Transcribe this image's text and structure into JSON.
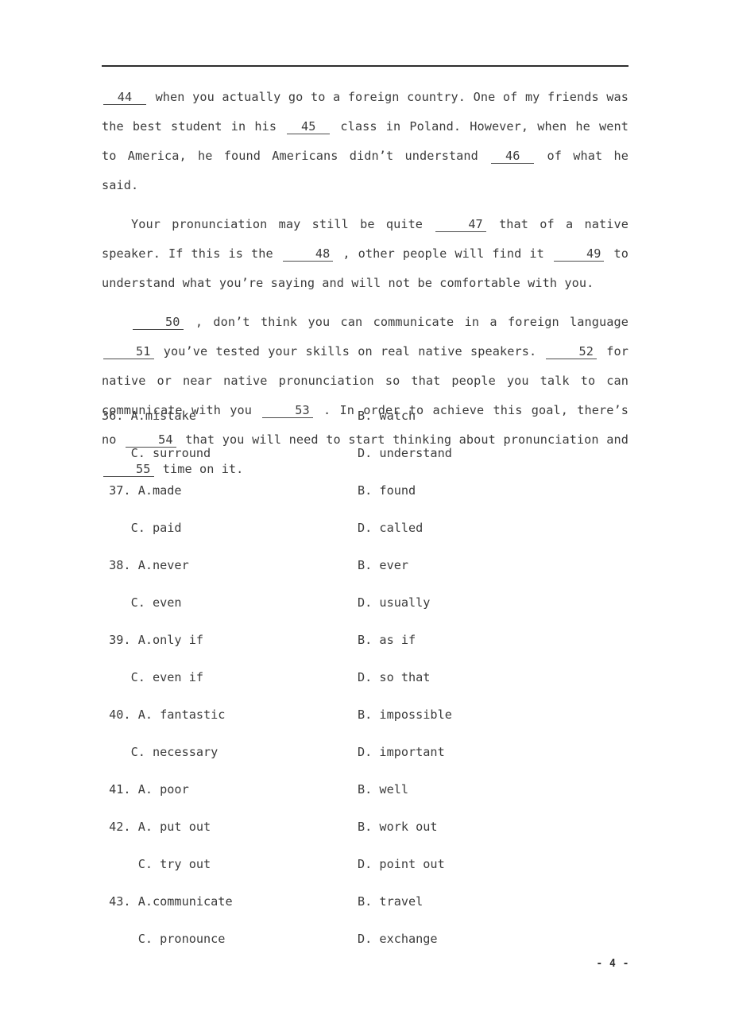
{
  "document": {
    "page_number_label": "- 4 -",
    "rule": true
  },
  "passage": {
    "paragraphs": [
      {
        "id": "p1",
        "indent": false,
        "segments": [
          {
            "type": "blank",
            "text": "44"
          },
          {
            "type": "text",
            "text": "  when you actually go to a foreign country. One of my friends was the best student in his "
          },
          {
            "type": "blank",
            "text": "45"
          },
          {
            "type": "text",
            "text": "  class in Poland. However, when he went to America, he found Americans didn’t understand "
          },
          {
            "type": "blank",
            "text": "46"
          },
          {
            "type": "text",
            "text": "  of what he said."
          }
        ]
      },
      {
        "id": "p2",
        "indent": true,
        "segments": [
          {
            "type": "text",
            "text": "Your pronunciation may still be quite "
          },
          {
            "type": "blank",
            "text": "47"
          },
          {
            "type": "text",
            "text": "  that of a native speaker. If this is the "
          },
          {
            "type": "blank",
            "text": "48"
          },
          {
            "type": "text",
            "text": " , other people will find it "
          },
          {
            "type": "blank",
            "text": "49"
          },
          {
            "type": "text",
            "text": "  to understand what you’re saying and will not be comfortable with you."
          }
        ]
      },
      {
        "id": "p3",
        "indent": true,
        "segments": [
          {
            "type": "blank",
            "text": "50"
          },
          {
            "type": "text",
            "text": " , don’t think you can communicate in a foreign language "
          },
          {
            "type": "blank",
            "text": "51"
          },
          {
            "type": "text",
            "text": "  you’ve tested your skills on real native speakers. "
          },
          {
            "type": "blank",
            "text": "52"
          },
          {
            "type": "text",
            "text": "  for native or near native pronunciation so that people you talk to can communicate with you "
          },
          {
            "type": "blank",
            "text": "53"
          },
          {
            "type": "text",
            "text": " . In order to achieve this goal, there’s no "
          },
          {
            "type": "blank",
            "text": "54"
          },
          {
            "type": "text",
            "text": "  that you will need to start thinking about pronunciation and "
          },
          {
            "type": "blank",
            "text": "55"
          },
          {
            "type": "text",
            "text": "  time on it."
          }
        ]
      }
    ]
  },
  "questions": [
    {
      "number": "36.",
      "rows": [
        {
          "left": "36. A.mistake",
          "right": "B. watch"
        },
        {
          "left": "    C. surround",
          "right": "D. understand"
        }
      ]
    },
    {
      "number": "37.",
      "rows": [
        {
          "left": " 37. A.made",
          "right": "B. found"
        },
        {
          "left": "    C. paid",
          "right": "D. called"
        }
      ]
    },
    {
      "number": "38.",
      "rows": [
        {
          "left": " 38. A.never",
          "right": "B. ever"
        },
        {
          "left": "    C. even",
          "right": "D. usually"
        }
      ]
    },
    {
      "number": "39.",
      "rows": [
        {
          "left": " 39. A.only if",
          "right": "B. as if"
        },
        {
          "left": "    C. even if",
          "right": "D. so that"
        }
      ]
    },
    {
      "number": "40.",
      "rows": [
        {
          "left": " 40. A. fantastic",
          "right": "B. impossible"
        },
        {
          "left": "    C. necessary",
          "right": "D. important"
        }
      ]
    },
    {
      "number": "41.",
      "rows": [
        {
          "left": " 41. A. poor",
          "right": "B. well"
        }
      ]
    },
    {
      "number": "42.",
      "rows": [
        {
          "left": " 42. A. put out",
          "right": "B. work out"
        },
        {
          "left": "     C. try out",
          "right": "D. point out"
        }
      ]
    },
    {
      "number": "43.",
      "rows": [
        {
          "left": " 43. A.communicate",
          "right": "B. travel"
        },
        {
          "left": "     C. pronounce",
          "right": "D. exchange"
        }
      ]
    }
  ]
}
